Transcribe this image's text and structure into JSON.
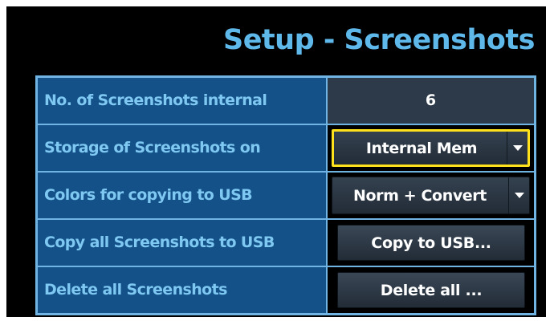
{
  "title": "Setup - Screenshots",
  "colors": {
    "title": "#5fb8ea",
    "label_bg": "#135188",
    "label_text": "#7ec8f2",
    "border": "#6fb4e2",
    "focus": "#ffe21c",
    "value_text": "#ffffff"
  },
  "rows": [
    {
      "label": "No. of Screenshots internal",
      "type": "display",
      "value": "6"
    },
    {
      "label": "Storage of Screenshots on",
      "type": "dropdown",
      "value": "Internal Mem",
      "icon": "chevron-down-icon",
      "focused": true
    },
    {
      "label": "Colors for copying to USB",
      "type": "dropdown",
      "value": "Norm + Convert",
      "icon": "chevron-down-icon",
      "focused": false
    },
    {
      "label": "Copy all Screenshots to USB",
      "type": "button",
      "value": "Copy to USB..."
    },
    {
      "label": "Delete all Screenshots",
      "type": "button",
      "value": "Delete all ..."
    }
  ]
}
